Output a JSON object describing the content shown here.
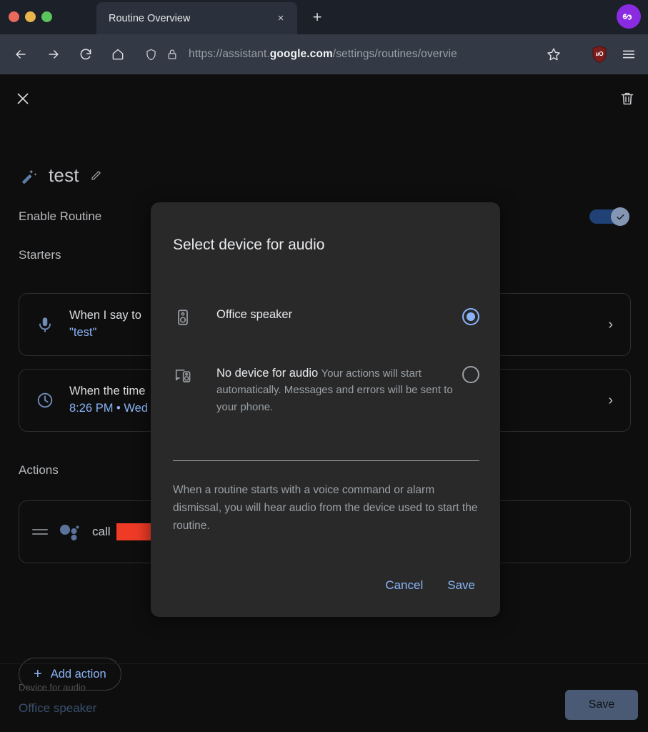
{
  "browser": {
    "tab": {
      "title": "Routine Overview",
      "close_label": "×"
    },
    "new_tab_label": "+",
    "avatar_label": "∞",
    "nav": {
      "back": "←",
      "forward": "→",
      "reload": "↻",
      "home": "⌂"
    },
    "url": {
      "scheme": "https://assistant.",
      "domain": "google.com",
      "path": "/settings/routines/overvie"
    },
    "extension_label": "uO",
    "menu_label": "☰"
  },
  "page": {
    "close_label": "✕",
    "delete_label": "delete",
    "routine_name": "test",
    "enable_label": "Enable Routine",
    "enable_on": true,
    "starters_label": "Starters",
    "actions_label": "Actions",
    "starters": [
      {
        "line1": "When I say to",
        "line2": "\"test\"",
        "icon": "microphone-icon",
        "chevron": "›"
      },
      {
        "line1": "When the time",
        "line2": "8:26 PM • Wed",
        "icon": "clock-icon",
        "chevron": "›"
      }
    ],
    "action": {
      "text": "call",
      "redacted": true
    },
    "add_action_label": "Add action",
    "add_action_plus": "+",
    "footer": {
      "device_label": "Device for audio",
      "device_value": "Office speaker",
      "save_label": "Save"
    }
  },
  "modal": {
    "title": "Select device for audio",
    "options": [
      {
        "name": "Office speaker",
        "description": "",
        "icon": "speaker-icon",
        "selected": true
      },
      {
        "name": "No device for audio",
        "description": "Your actions will start automatically. Messages and errors will be sent to your phone.",
        "icon": "cast-speaker-icon",
        "selected": false
      }
    ],
    "note": "When a routine starts with a voice command or alarm dismissal, you will hear audio from the device used to start the routine.",
    "cancel_label": "Cancel",
    "save_label": "Save"
  },
  "colors": {
    "accent_blue": "#8ab4f8",
    "redaction_red": "#ef3b26",
    "page_bg": "#0e0e0e",
    "modal_bg": "#292929"
  }
}
